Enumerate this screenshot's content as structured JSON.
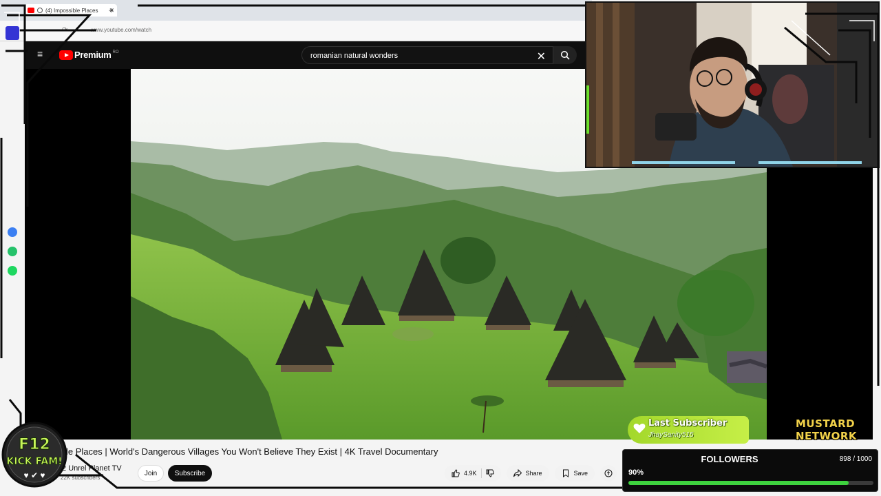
{
  "browser": {
    "tab_title": "(4) Impossible Places",
    "new_tab": "+",
    "url": "www.youtube.com/watch"
  },
  "youtube": {
    "logo_text": "Premium",
    "region": "RO",
    "search_query": "romanian natural wonders",
    "clear_icon": "✕"
  },
  "video": {
    "title_prefix": "le Places",
    "title": "World's Dangerous Villages You Won't Believe They Exist | 4K Travel Documentary",
    "channel": "Unrel Planet TV",
    "channel_prefix": "2",
    "subscribers": "22K subscribers",
    "join_label": "Join",
    "subscribe_label": "Subscribe",
    "likes": "4.9K",
    "share_label": "Share",
    "save_label": "Save"
  },
  "overlay": {
    "kick_line1": "F12",
    "kick_line2": "KICK FAM!",
    "last_subscriber_title": "Last Subscriber",
    "last_subscriber_name": "JhaySanity515",
    "network_line1": "MUSTARD",
    "network_line2": "NETWORK",
    "followers_title": "FOLLOWERS",
    "followers_count": "898 / 1000",
    "followers_percent": "90%",
    "followers_progress": 0.898
  },
  "colors": {
    "youtube_red": "#ff0000",
    "follow_green": "#3ed23e",
    "sub_green": "#b6e43a",
    "mustard": "#f2d24a"
  }
}
